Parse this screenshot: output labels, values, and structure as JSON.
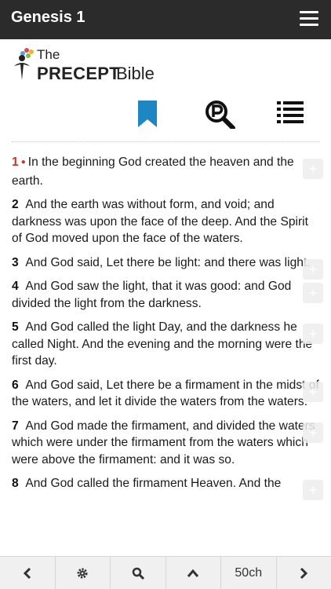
{
  "header": {
    "title": "Genesis 1",
    "menu_icon": "hamburger-icon"
  },
  "logo": {
    "line1": "The",
    "line2a": "PRECEPT",
    "line2b": "Bible"
  },
  "toolbar": {
    "icons": [
      "bookmark-icon",
      "precept-search-icon",
      "list-icon"
    ],
    "accent_color": "#1f86c4"
  },
  "verses": [
    {
      "num": "1",
      "text": "In the beginning God created the heaven and the earth."
    },
    {
      "num": "2",
      "text": "And the earth was without form, and void; and darkness was upon the face of the deep. And the Spirit of God moved upon the face of the waters."
    },
    {
      "num": "3",
      "text": "And God said, Let there be light: and there was light."
    },
    {
      "num": "4",
      "text": "And God saw the light, that it was good: and God divided the light from the darkness."
    },
    {
      "num": "5",
      "text": "And God called the light Day, and the darkness he called Night. And the evening and the morning were the first day."
    },
    {
      "num": "6",
      "text": "And God said, Let there be a firmament in the midst of the waters, and let it divide the waters from the waters."
    },
    {
      "num": "7",
      "text": "And God made the firmament, and divided the waters which were under the firmament from the waters which were above the firmament: and it was so."
    },
    {
      "num": "8",
      "text": "And God called the firmament Heaven. And the"
    }
  ],
  "bottom": {
    "chapter_label": "50ch"
  }
}
